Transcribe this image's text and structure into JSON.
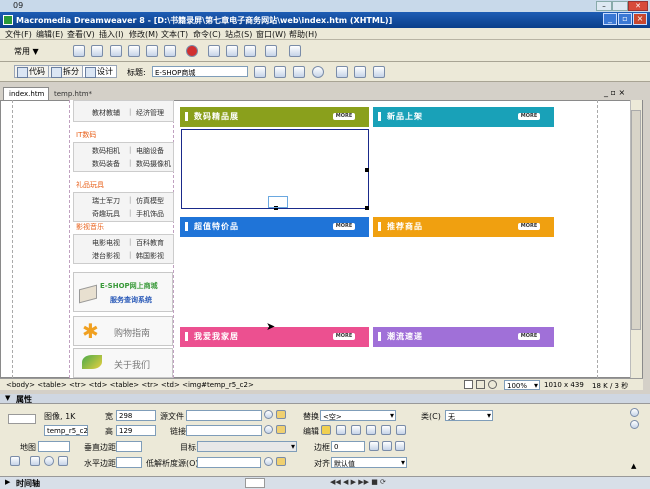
{
  "vista_title": "09",
  "app_title": "Macromedia Dreamweaver 8 - [D:\\书籍录屏\\第七章电子商务网站\\web\\index.htm (XHTML)]",
  "menu": [
    "文件(F)",
    "编辑(E)",
    "查看(V)",
    "插入(I)",
    "修改(M)",
    "文本(T)",
    "命令(C)",
    "站点(S)",
    "窗口(W)",
    "帮助(H)"
  ],
  "insert_category": "常用",
  "doc_toolbar": {
    "code": "代码",
    "split": "拆分",
    "design": "设计",
    "title_label": "标题:",
    "title_value": "E-SHOP商城"
  },
  "tabs": [
    "index.htm",
    "temp.htm*"
  ],
  "sidebar": {
    "top_row": [
      "教材教辅",
      "经济管理"
    ],
    "groups": [
      {
        "title": "IT数码",
        "rows": [
          [
            "数码相机",
            "电脑设备"
          ],
          [
            "数码装备",
            "数码摄像机"
          ]
        ]
      },
      {
        "title": "礼品玩具",
        "rows": [
          [
            "瑞士军刀",
            "仿真模型"
          ],
          [
            "奇趣玩具",
            "手机饰品"
          ]
        ]
      },
      {
        "title": "影视音乐",
        "rows": [
          [
            "电影电视",
            "百科教育"
          ],
          [
            "港台影视",
            "韩国影视"
          ]
        ]
      }
    ],
    "banner_query": {
      "line1": "E-SHOP网上商城",
      "line2": "服务查询系统"
    },
    "banner_guide": "购物指南",
    "banner_about": "关于我们"
  },
  "sections": [
    {
      "title": "数码精品展",
      "more": "MORE",
      "color": "#8aa01c"
    },
    {
      "title": "新品上架",
      "more": "MORE",
      "color": "#19a1b8"
    },
    {
      "title": "超值特价品",
      "more": "MORE",
      "color": "#1f74d8"
    },
    {
      "title": "推荐商品",
      "more": "MORE",
      "color": "#f0a010"
    },
    {
      "title": "我爱我家居",
      "more": "MORE",
      "color": "#ec5090"
    },
    {
      "title": "潮流速递",
      "more": "MORE",
      "color": "#a070d8"
    }
  ],
  "tag_path": "<body> <table> <tr> <td> <table> <tr> <td> <img#temp_r5_c2>",
  "status": {
    "zoom": "100%",
    "size": "1010 x 439",
    "filesize": "18 K / 3 秒"
  },
  "properties": {
    "panel_title": "属性",
    "image_label": "图像, 1K",
    "id_value": "temp_r5_c2",
    "width_label": "宽",
    "width_value": "298",
    "height_label": "高",
    "height_value": "129",
    "src_label": "源文件",
    "src_value": "",
    "link_label": "链接",
    "link_value": "",
    "alt_label": "替换",
    "alt_value": "<空>",
    "class_label": "类(C)",
    "class_value": "无",
    "edit_label": "编辑",
    "map_label": "地图",
    "vspace_label": "垂直边距",
    "hspace_label": "水平边距",
    "target_label": "目标",
    "lowsrc_label": "低解析度源(O)",
    "border_label": "边框",
    "border_value": "0",
    "align_label": "对齐",
    "align_value": "默认值"
  },
  "timeline_label": "时间轴"
}
